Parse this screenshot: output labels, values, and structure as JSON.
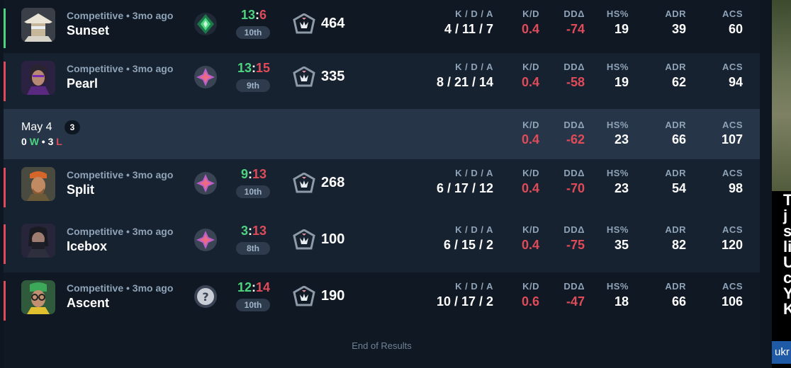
{
  "matches": [
    {
      "meta": "Competitive • 3mo ago",
      "map": "Sunset",
      "win": "13",
      "loss": "6",
      "place": "10th",
      "rr": "464",
      "kda": "4 / 11 / 7",
      "kd": "0.4",
      "dd": "-74",
      "hs": "19",
      "adr": "39",
      "acs": "60",
      "result": "win",
      "rank_icon": "ascendant-rank-icon",
      "agent_icon": "agent-cypher-icon"
    },
    {
      "meta": "Competitive • 3mo ago",
      "map": "Pearl",
      "win": "13",
      "loss": "15",
      "place": "9th",
      "rr": "335",
      "kda": "8 / 21 / 14",
      "kd": "0.4",
      "dd": "-58",
      "hs": "19",
      "adr": "62",
      "acs": "94",
      "result": "loss",
      "rank_icon": "diamond-rank-icon",
      "agent_icon": "agent-reyna-icon"
    },
    {
      "meta": "Competitive • 3mo ago",
      "map": "Split",
      "win": "9",
      "loss": "13",
      "place": "10th",
      "rr": "268",
      "kda": "6 / 17 / 12",
      "kd": "0.4",
      "dd": "-70",
      "hs": "23",
      "adr": "54",
      "acs": "98",
      "result": "loss",
      "rank_icon": "diamond-rank-icon",
      "agent_icon": "agent-kayo-icon"
    },
    {
      "meta": "Competitive • 3mo ago",
      "map": "Icebox",
      "win": "3",
      "loss": "13",
      "place": "8th",
      "rr": "100",
      "kda": "6 / 15 / 2",
      "kd": "0.4",
      "dd": "-75",
      "hs": "35",
      "adr": "82",
      "acs": "120",
      "result": "loss",
      "rank_icon": "diamond-rank-icon",
      "agent_icon": "agent-fade-icon"
    },
    {
      "meta": "Competitive • 3mo ago",
      "map": "Ascent",
      "win": "12",
      "loss": "14",
      "place": "10th",
      "rr": "190",
      "kda": "10 / 17 / 2",
      "kd": "0.6",
      "dd": "-47",
      "hs": "18",
      "adr": "66",
      "acs": "106",
      "result": "loss",
      "rank_icon": "unknown-rank-icon",
      "agent_icon": "agent-killjoy-icon"
    }
  ],
  "labels": {
    "kda": "K / D / A",
    "kd": "K/D",
    "dd": "DDΔ",
    "hs": "HS%",
    "adr": "ADR",
    "acs": "ACS",
    "sep": ":",
    "w": "W",
    "l": "L",
    "dot": "•"
  },
  "summary": {
    "date": "May 4",
    "count": "3",
    "wins": "0",
    "losses": "3",
    "kd": "0.4",
    "dd": "-62",
    "hs": "23",
    "adr": "66",
    "acs": "107"
  },
  "footer": {
    "end_text": "End of Results"
  },
  "ad": {
    "text": "T j s li U c Y K",
    "link": "ukr"
  },
  "colors": {
    "win": "#4ed37f",
    "loss": "#e04b5a",
    "panel": "#101923",
    "summary": "#263548"
  }
}
